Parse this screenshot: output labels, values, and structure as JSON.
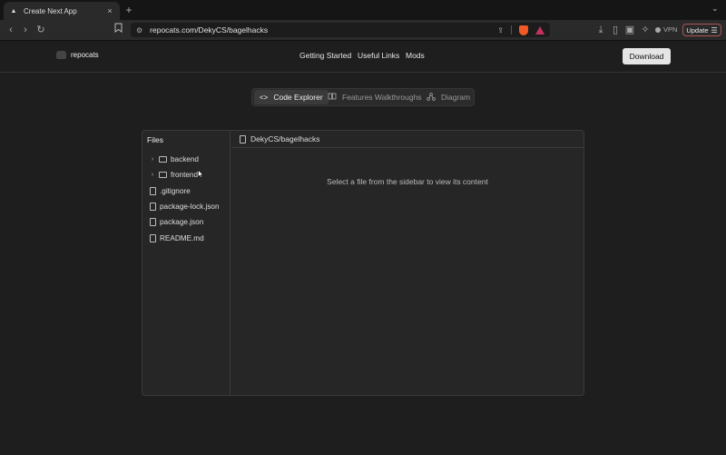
{
  "browser": {
    "tab_title": "Create Next App",
    "tab_close": "×",
    "new_tab": "+",
    "tab_menu": "⌄",
    "back": "‹",
    "forward": "›",
    "reload": "↻",
    "bookmark": "🔖",
    "url": "repocats.com/DekyCS/bagelhacks",
    "vpn_label": "VPN",
    "update_label": "Update",
    "download_icon": "⤓",
    "sidebar_icon": "▯",
    "wallet_icon": "▣",
    "leo_icon": "✧"
  },
  "site": {
    "brand": "repocats",
    "nav": [
      "Getting Started",
      "Useful Links",
      "Mods"
    ],
    "download_label": "Download"
  },
  "tabs": [
    {
      "icon": "<>",
      "label": "Code Explorer",
      "active": true
    },
    {
      "icon": "📖",
      "label": "Features Walkthroughs",
      "active": false
    },
    {
      "icon": "⛬",
      "label": "Diagram",
      "active": false
    }
  ],
  "explorer": {
    "sidebar_title": "Files",
    "breadcrumb": "DekyCS/bagelhacks",
    "empty_message": "Select a file from the sidebar to view its content",
    "items": [
      {
        "type": "folder",
        "name": "backend"
      },
      {
        "type": "folder",
        "name": "frontend"
      },
      {
        "type": "file",
        "name": ".gitignore"
      },
      {
        "type": "file",
        "name": "package-lock.json"
      },
      {
        "type": "file",
        "name": "package.json"
      },
      {
        "type": "file",
        "name": "README.md"
      }
    ]
  },
  "colors": {
    "background": "#1e1e1e",
    "panel": "#262626",
    "download_button": "#e5e5e5"
  }
}
